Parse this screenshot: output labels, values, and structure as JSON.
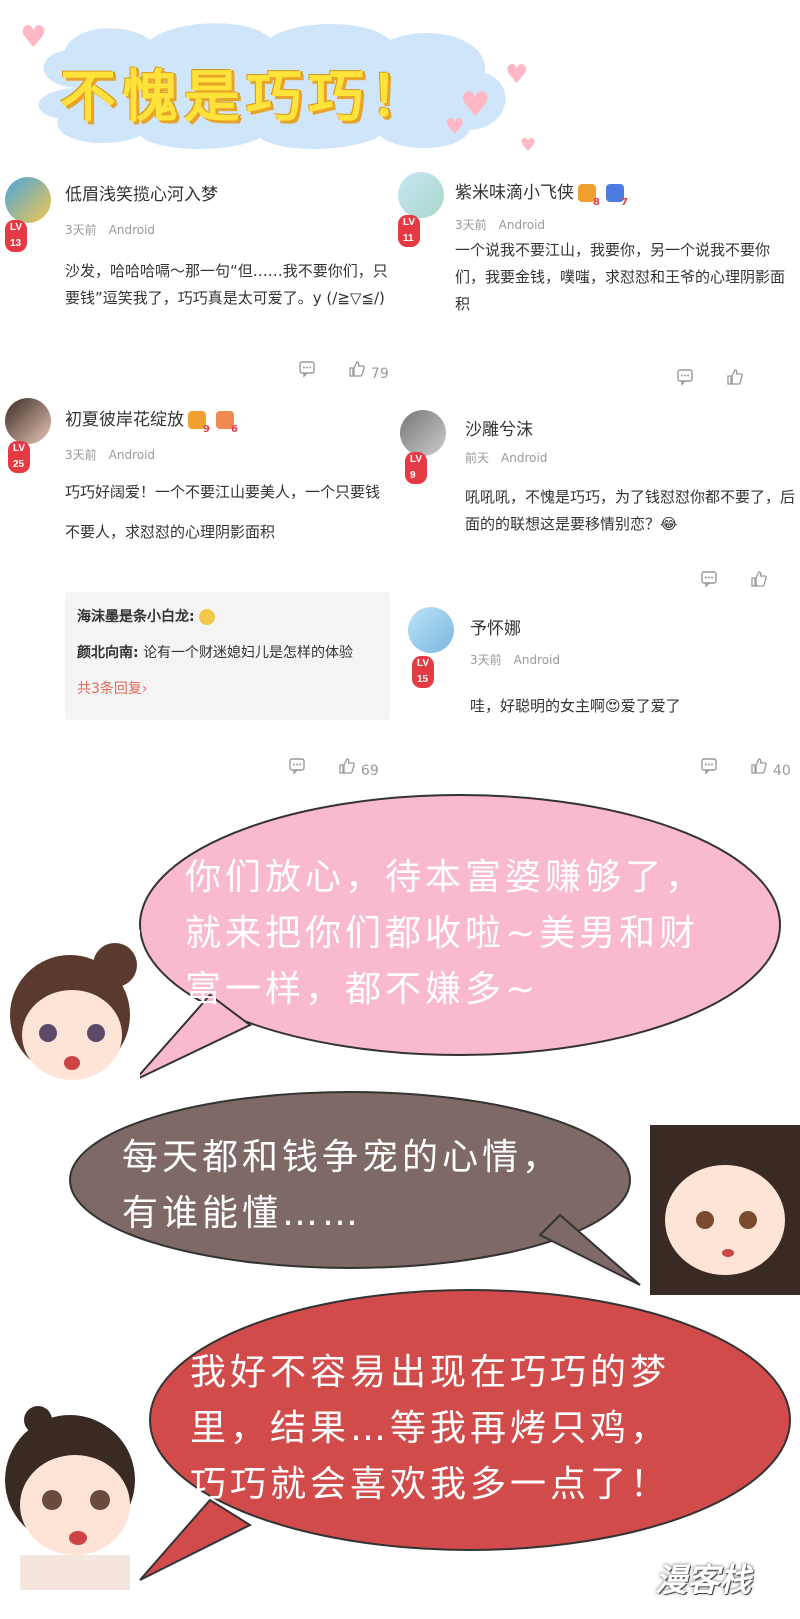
{
  "header": {
    "title": "不愧是巧巧！"
  },
  "comments": [
    {
      "username": "低眉浅笑揽心河入梦",
      "level": "LV 13",
      "time": "3天前",
      "device": "Android",
      "text": "沙发，哈哈哈嗝～那一句“但……我不要你们，只要钱”逗笑我了，巧巧真是太可爱了。y (/≧▽≦/)",
      "likes": "79"
    },
    {
      "username": "紫米味滴小飞侠",
      "level": "LV 11",
      "badges": [
        "8",
        "7"
      ],
      "time": "3天前",
      "device": "Android",
      "text": "一个说我不要江山，我要你，另一个说我不要你们，我要金钱，噗嗤，求怼怼和王爷的心理阴影面积"
    },
    {
      "username": "初夏彼岸花绽放",
      "level": "LV 25",
      "badges": [
        "9",
        "6"
      ],
      "time": "3天前",
      "device": "Android",
      "text": "巧巧好阔爱！一个不要江山要美人，一个只要钱不要人，求怼怼的心理阴影面积",
      "replies": [
        {
          "author": "海沫墨是条小白龙:",
          "text": ""
        },
        {
          "author": "颜北向南:",
          "text": "论有一个财迷媳妇儿是怎样的体验"
        }
      ],
      "reply_more": "共3条回复›",
      "likes": "69"
    },
    {
      "username": "沙雕兮沫",
      "level": "LV 9",
      "time": "前天",
      "device": "Android",
      "text": "吼吼吼，不愧是巧巧，为了钱怼怼你都不要了，后面的的联想这是要移情别恋？😂"
    },
    {
      "username": "予怀娜",
      "level": "LV 15",
      "time": "3天前",
      "device": "Android",
      "text": "哇，好聪明的女主啊😍爱了爱了",
      "likes": "40"
    }
  ],
  "bubbles": [
    {
      "text": "你们放心，待本富婆赚够了，\n就来把你们都收啦~美男和财\n富一样，都不嫌多~",
      "color": "#f9b9cf"
    },
    {
      "text": "每天都和钱争宠的心情，\n有谁能懂……",
      "color": "#7e6966"
    },
    {
      "text": "我好不容易出现在巧巧的梦\n里，结果…等我再烤只鸡，\n巧巧就会喜欢我多一点了！",
      "color": "#d24b4b"
    }
  ],
  "watermark": "漫客栈"
}
